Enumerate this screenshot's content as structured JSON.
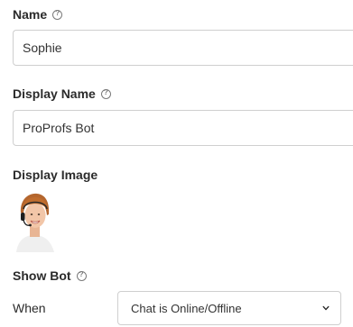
{
  "name": {
    "label": "Name",
    "value": "Sophie"
  },
  "display_name": {
    "label": "Display Name",
    "value": "ProProfs Bot"
  },
  "display_image": {
    "label": "Display Image"
  },
  "show_bot": {
    "label": "Show Bot",
    "when_label": "When",
    "selected": "Chat is Online/Offline"
  }
}
